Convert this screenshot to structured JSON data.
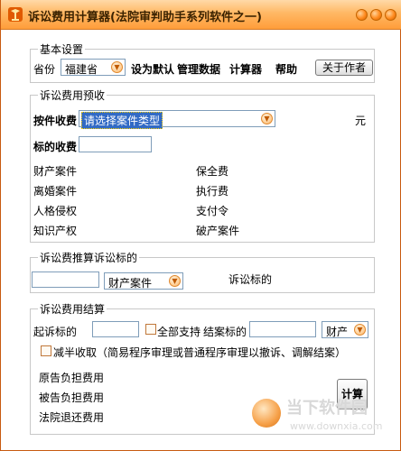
{
  "window": {
    "title": "诉讼费用计算器(法院审判助手系列软件之一)"
  },
  "basic": {
    "legend": "基本设置",
    "province_label": "省份",
    "province_value": "福建省",
    "set_default": "设为默认",
    "manage_data": "管理数据",
    "calculator": "计算器",
    "help": "帮助",
    "about": "关于作者"
  },
  "prepay": {
    "legend": "诉讼费用预收",
    "case_fee_label": "按件收费",
    "case_type_value": "请选择案件类型",
    "unit": "元",
    "amount_fee_label": "标的收费",
    "items_left": [
      "财产案件",
      "离婚案件",
      "人格侵权",
      "知识产权"
    ],
    "items_right": [
      "保全费",
      "执行费",
      "支付令",
      "破产案件"
    ]
  },
  "reverse": {
    "legend": "诉讼费推算诉讼标的",
    "case_type_value": "财产案件",
    "result_label": "诉讼标的"
  },
  "settle": {
    "legend": "诉讼费用结算",
    "claim_label": "起诉标的",
    "all_support_label": "全部支持",
    "settle_label": "结案标的",
    "case_type_value": "财产",
    "half_label": "减半收取（简易程序审理或普通程序审理以撤诉、调解结案）",
    "plaintiff": "原告负担费用",
    "defendant": "被告负担费用",
    "refund": "法院退还费用",
    "calc_button": "计算"
  },
  "watermark": {
    "cn": "当下软件园",
    "url": "www.downxia.com"
  }
}
